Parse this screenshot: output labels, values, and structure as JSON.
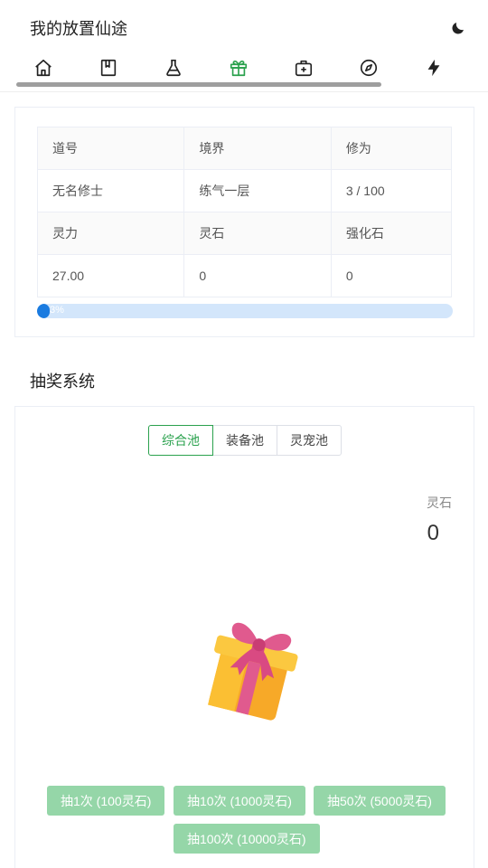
{
  "header": {
    "title": "我的放置仙途"
  },
  "nav": {
    "items": [
      {
        "icon": "home-icon",
        "active": false
      },
      {
        "icon": "book-icon",
        "active": false
      },
      {
        "icon": "flask-icon",
        "active": false
      },
      {
        "icon": "gift-icon",
        "active": true
      },
      {
        "icon": "medkit-icon",
        "active": false
      },
      {
        "icon": "compass-icon",
        "active": false
      },
      {
        "icon": "lightning-icon",
        "active": false
      }
    ],
    "active_color": "#2aa14d"
  },
  "stats": {
    "labels_row1": [
      "道号",
      "境界",
      "修为"
    ],
    "values_row1": [
      "无名修士",
      "练气一层",
      "3 / 100"
    ],
    "labels_row2": [
      "灵力",
      "灵石",
      "强化石"
    ],
    "values_row2": [
      "27.00",
      "0",
      "0"
    ],
    "progress_percent": 3,
    "progress_text": "3%"
  },
  "gacha": {
    "section_title": "抽奖系统",
    "pools": [
      "综合池",
      "装备池",
      "灵宠池"
    ],
    "active_pool": "综合池",
    "stone_label": "灵石",
    "stone_value": "0",
    "buttons": [
      "抽1次 (100灵石)",
      "抽10次 (1000灵石)",
      "抽50次 (5000灵石)",
      "抽100次 (10000灵石)"
    ]
  },
  "colors": {
    "accent_green": "#2aa14d",
    "disabled_button": "#95d6a8",
    "progress_fill": "#1a7be0",
    "progress_track": "#d3e6fb"
  }
}
